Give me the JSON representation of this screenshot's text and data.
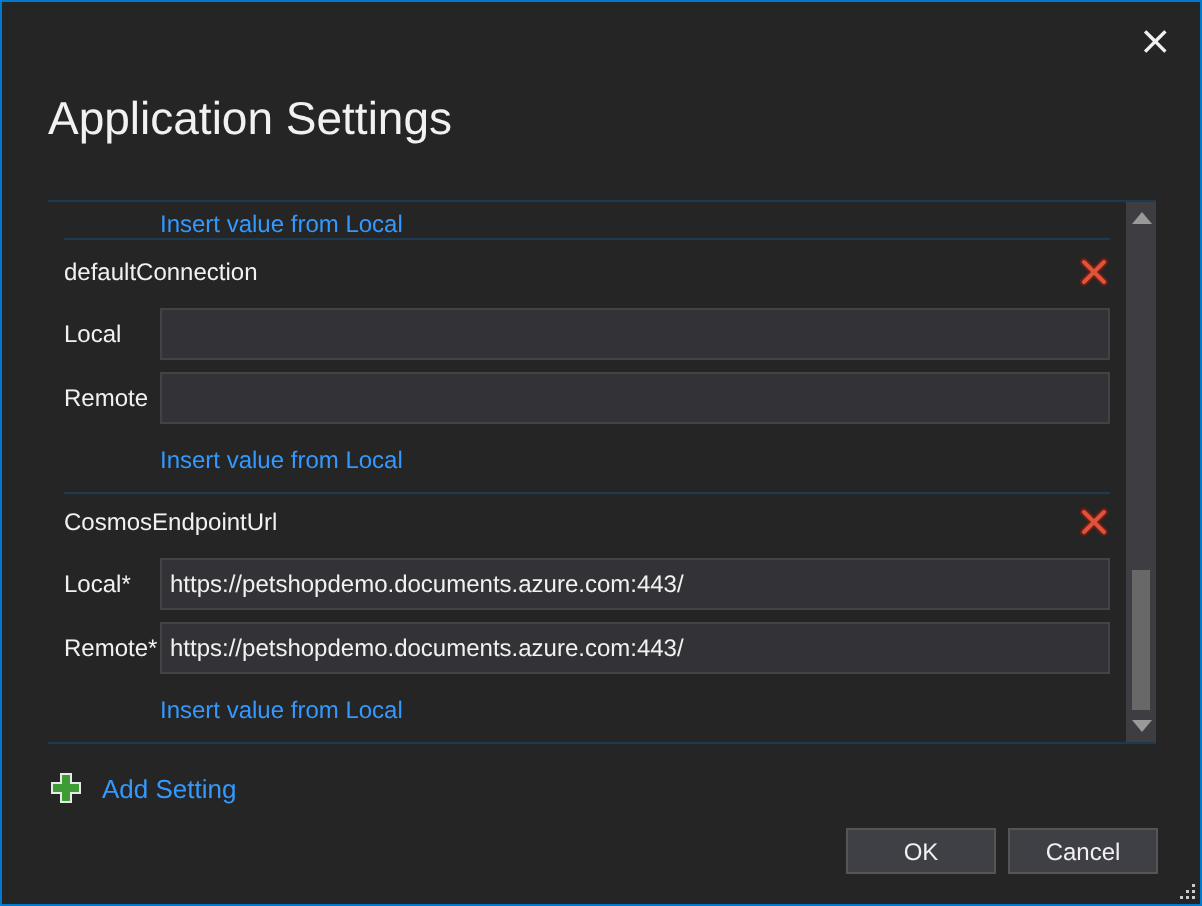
{
  "dialog": {
    "title": "Application Settings",
    "close": "×"
  },
  "settings": {
    "top_link": "Insert value from Local",
    "items": [
      {
        "name": "defaultConnection",
        "fields": [
          {
            "label": "Local"
          },
          {
            "label": "Remote"
          }
        ],
        "link": "Insert value from Local"
      },
      {
        "name": "CosmosEndpointUrl",
        "fields": [
          {
            "label": "Local*",
            "value": "https://petshopdemo.documents.azure.com:443/"
          },
          {
            "label": "Remote*",
            "value": "https://petshopdemo.documents.azure.com:443/"
          }
        ],
        "link": "Insert value from Local"
      }
    ]
  },
  "add_setting": "Add Setting",
  "buttons": [
    "OK",
    "Cancel"
  ]
}
